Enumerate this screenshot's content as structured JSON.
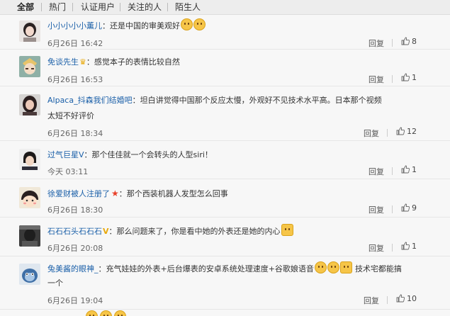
{
  "tabs": [
    "全部",
    "热门",
    "认证用户",
    "关注的人",
    "陌生人"
  ],
  "active_tab": 0,
  "reply_label": "回复",
  "comments": [
    {
      "username": "小小小小小薰儿",
      "text": "：还是中国的审美观好",
      "emojis": 2,
      "time": "6月26日 16:42",
      "likes": "8"
    },
    {
      "username": "免谈先生",
      "text": "：感觉本子的表情比较自然",
      "time": "6月26日 16:53",
      "likes": "1"
    },
    {
      "username": "Alpaca_抖森我们结婚吧",
      "text": "：坦白讲觉得中国那个反应太慢，外观好不见技术水平高。日本那个视频",
      "text2": "太短不好评价",
      "time": "6月26日 18:34",
      "likes": "12"
    },
    {
      "username": "过气巨星V",
      "text": "：那个佳佳就一个会转头的人型siri！",
      "time": "今天 03:11",
      "likes": "1"
    },
    {
      "username": "徐爱财被人注册了",
      "text": "：那个西装机器人发型怎么回事",
      "time": "6月26日 18:30",
      "likes": "9"
    },
    {
      "username": "石石石头石石石",
      "text": "：那么问题来了，你是看中她的外表还是她的内心",
      "time": "6月26日 20:08",
      "likes": "1"
    },
    {
      "username": "兔美酱的眼神_",
      "text": "：充气娃娃的外表+后台爆表的安卓系统处理速度+谷歌娘语音",
      "text_after": "技术宅都能搞",
      "text2": "一个",
      "time": "6月26日 19:04",
      "likes": "10"
    }
  ],
  "colors": {
    "username": "#1a5fa8",
    "background": "#f7f7f7",
    "tab_bar": "#ededed",
    "badge_gold": "#e8a90b",
    "badge_red": "#e8402a"
  }
}
